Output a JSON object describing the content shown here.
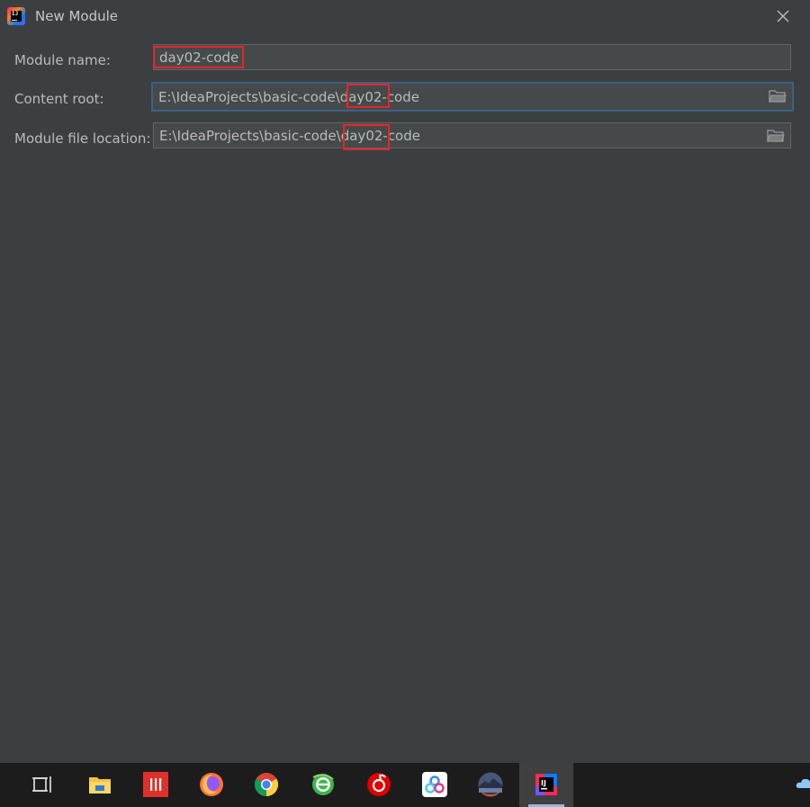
{
  "window": {
    "title": "New Module",
    "app_icon": "intellij-idea-icon",
    "close_icon": "close-icon"
  },
  "form": {
    "module_name": {
      "label": "Module name:",
      "value": "day02-code"
    },
    "content_root": {
      "label": "Content root:",
      "value": "E:\\IdeaProjects\\basic-code\\day02-code",
      "browse_icon": "folder-icon"
    },
    "module_file_location": {
      "label": "Module file location:",
      "value": "E:\\IdeaProjects\\basic-code\\day02-code",
      "browse_icon": "folder-icon"
    }
  },
  "colors": {
    "background": "#3c3f41",
    "field_background": "#45494a",
    "focus_border": "#3d6185",
    "annotation": "#e5262b",
    "text": "#bbbbbb",
    "taskbar": "#1c1c1c"
  },
  "taskbar": {
    "items": [
      {
        "icon": "task-view-icon"
      },
      {
        "icon": "file-explorer-icon"
      },
      {
        "icon": "red-app-icon"
      },
      {
        "icon": "firefox-icon"
      },
      {
        "icon": "chrome-icon"
      },
      {
        "icon": "360-browser-icon"
      },
      {
        "icon": "netease-music-icon"
      },
      {
        "icon": "baidu-netdisk-icon"
      },
      {
        "icon": "photo-app-icon"
      },
      {
        "icon": "intellij-idea-icon",
        "active": true
      }
    ],
    "tray_icon": "onedrive-cloud-icon"
  }
}
